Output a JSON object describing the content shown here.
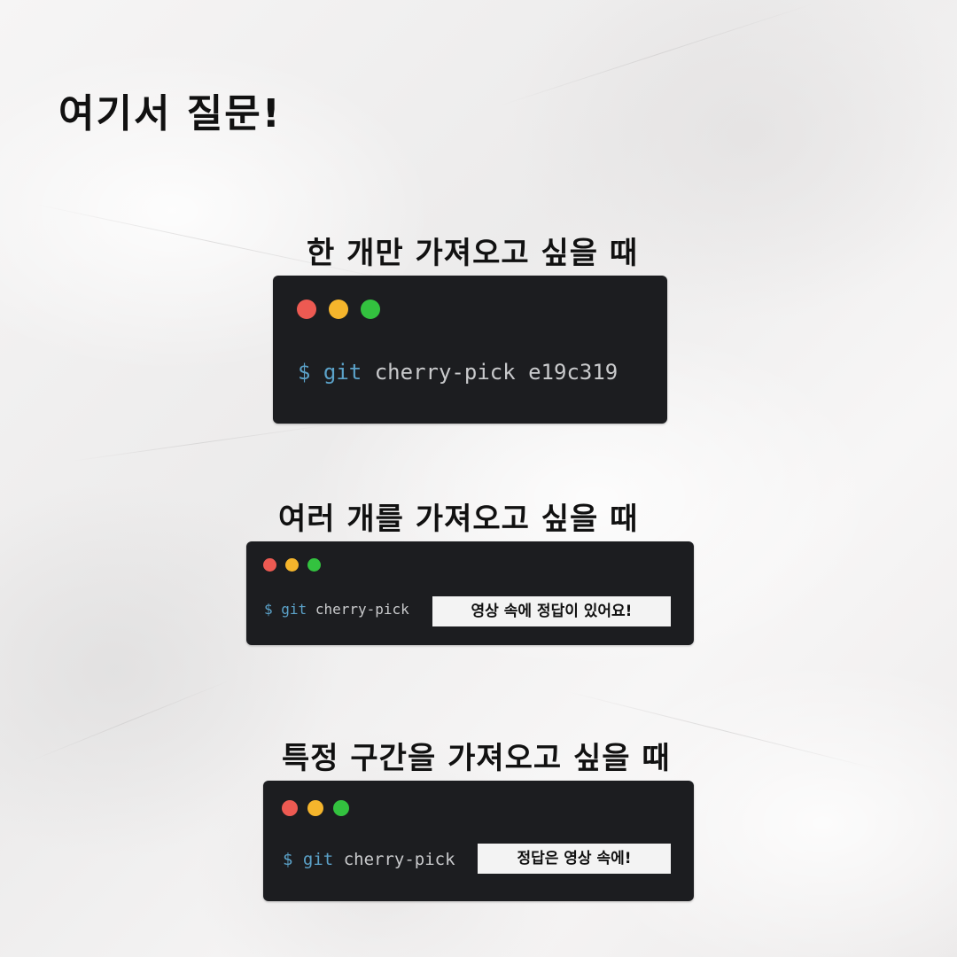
{
  "heading": "여기서 질문!",
  "sections": [
    {
      "title": "한 개만 가져오고 싶을 때",
      "prompt": "$",
      "command": "git",
      "args": "cherry-pick e19c319"
    },
    {
      "title": "여러 개를 가져오고 싶을 때",
      "prompt": "$",
      "command": "git",
      "args": "cherry-pick",
      "answer": "영상 속에 정답이 있어요!"
    },
    {
      "title": "특정 구간을 가져오고 싶을 때",
      "prompt": "$",
      "command": "git",
      "args": "cherry-pick",
      "answer": "정답은 영상 속에!"
    }
  ],
  "window_controls": {
    "close": "#ed5a52",
    "minimize": "#f5b52c",
    "maximize": "#33c23f"
  },
  "colors": {
    "background": "#f2f1f1",
    "terminal_bg": "#1c1d20",
    "command_accent": "#5ba2c9",
    "command_text": "#c9cacc",
    "answer_box": "#f3f3f3"
  }
}
